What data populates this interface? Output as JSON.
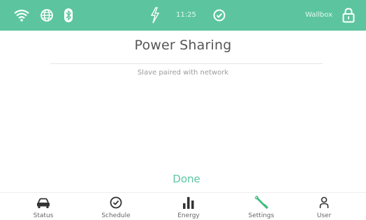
{
  "status_bar": {
    "time": "11:25",
    "device_name": "Wallbox",
    "background_color": "#5cc5a0",
    "icons": [
      "wifi-icon",
      "globe-icon",
      "bluetooth-icon",
      "power-sharing-icon",
      "check-circle-icon",
      "lock-icon"
    ]
  },
  "page": {
    "title": "Power Sharing",
    "message": "Slave paired with network",
    "done_label": "Done",
    "accent_color": "#5cc5a0"
  },
  "nav": {
    "items": [
      {
        "label": "Status",
        "icon": "car-icon",
        "active": false
      },
      {
        "label": "Schedule",
        "icon": "clock-check-icon",
        "active": false
      },
      {
        "label": "Energy",
        "icon": "bar-chart-icon",
        "active": false
      },
      {
        "label": "Settings",
        "icon": "wrench-icon",
        "active": true
      },
      {
        "label": "User",
        "icon": "user-icon",
        "active": false
      }
    ]
  }
}
